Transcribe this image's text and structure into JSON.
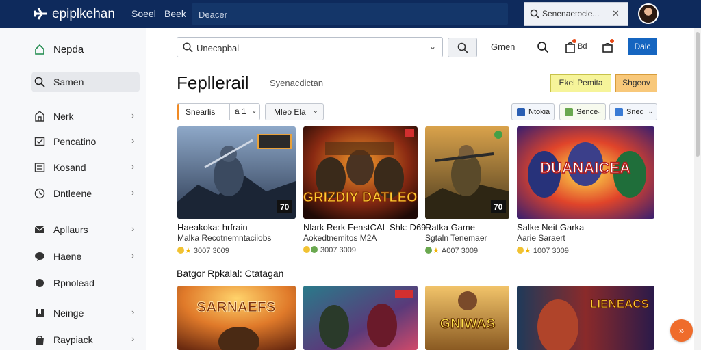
{
  "app": {
    "brand": "epiplkehan",
    "nav": [
      "Soeel",
      "Beek"
    ],
    "top_search_placeholder": "Deacer",
    "top_right_search": {
      "text": "Senenaetocie...",
      "close": "✕"
    }
  },
  "sidebar": {
    "items": [
      {
        "label": "Nepda",
        "icon": "home-icon"
      },
      {
        "label": "Samen",
        "icon": "search-icon",
        "active": true
      },
      {
        "label": "Nerk",
        "icon": "store-icon",
        "chevron": "›"
      },
      {
        "label": "Pencatino",
        "icon": "inbox-icon",
        "chevron": "›"
      },
      {
        "label": "Kosand",
        "icon": "list-icon",
        "chevron": "›"
      },
      {
        "label": "Dntleene",
        "icon": "clock-icon",
        "chevron": "›"
      },
      {
        "label": "Apllaurs",
        "icon": "mail-icon",
        "chevron": "›"
      },
      {
        "label": "Haene",
        "icon": "chat-icon",
        "chevron": "›"
      },
      {
        "label": "Rpnolead",
        "icon": "circle-icon"
      },
      {
        "label": "Neinge",
        "icon": "bookmark-icon",
        "chevron": "›"
      },
      {
        "label": "Raypiack",
        "icon": "bag-icon",
        "chevron": "›"
      }
    ]
  },
  "toolbar": {
    "search_placeholder": "Unecapbal",
    "search_chevron": "⌄",
    "text_link": "Gmen",
    "small_label": "Bd",
    "primary_label": "Dalc"
  },
  "header": {
    "title": "Fepllerail",
    "subtitle": "Syenacdictan",
    "btn_yellow": "Ekel Pemita",
    "btn_orange": "Shgeov"
  },
  "filters": {
    "segment_a": "Snearlis",
    "segment_b": "a  1",
    "dropdown": "Mleo Ela",
    "chips": [
      {
        "label": "Ntokia",
        "color": "#2b5fb3"
      },
      {
        "label": "Sence",
        "color": "#6aa84f"
      },
      {
        "label": "Sned",
        "color": "#3a7bd5"
      }
    ],
    "chevron": "⌄"
  },
  "cards_row1": [
    {
      "title": "Haeakoka: hrfrain",
      "subtitle": "Malka Recotnemntaciiobs",
      "meta": "3007 3009",
      "badge": "70",
      "art_text": ""
    },
    {
      "title": "Nlark Rerk FenstCAL Shk: D69",
      "subtitle": "Aokedtnemitos M2A",
      "meta": "3007 3009",
      "badge": "",
      "art_text": "GRIZDIY DATLEO"
    },
    {
      "title": "Ratka Game",
      "subtitle": "Sgtaln Tenemaer",
      "meta": "A007 3009",
      "badge": "70",
      "art_text": ""
    },
    {
      "title": "Salke Neit Garka",
      "subtitle": "Aarie Saraert",
      "meta": "1007 3009",
      "badge": "",
      "art_text": "DUANAICEA"
    }
  ],
  "section_title": "Batgor Rpkalal: Ctatagan",
  "cards_row2": [
    {
      "art_text": "SARNAEFS"
    },
    {
      "art_text": ""
    },
    {
      "art_text": "GNIWAS"
    },
    {
      "art_text": "LIENEACS"
    }
  ],
  "fab_label": "»",
  "colors": {
    "topbar": "#0e2a5c",
    "primary": "#1565c0",
    "accent": "#f08a24"
  }
}
